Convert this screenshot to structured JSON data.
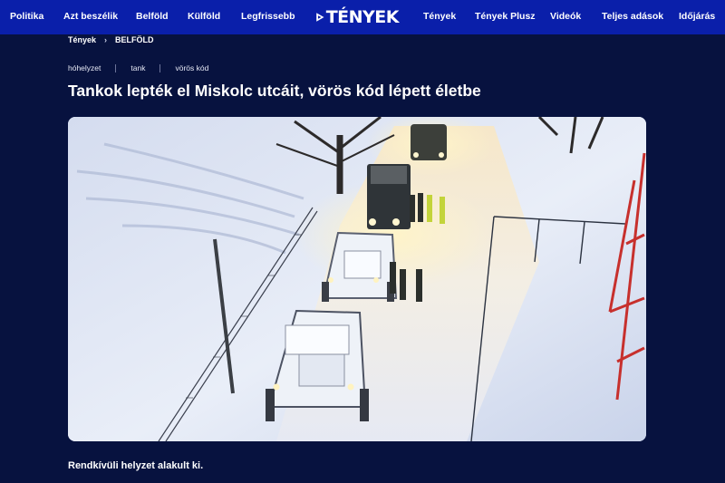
{
  "nav": {
    "left_items": [
      "Politika",
      "Azt beszélik",
      "Belföld",
      "Külföld",
      "Legfrissebb"
    ],
    "logo_text": "TÉNYEK",
    "right_items": [
      "Tények",
      "Tények Plusz",
      "Videók",
      "Teljes adások",
      "Időjárás"
    ],
    "colors": {
      "bar": "#0a1faa",
      "page": "#07123f"
    }
  },
  "breadcrumb": {
    "home": "Tények",
    "separator_icon": "chevron-right-icon",
    "current": "BELFÖLD"
  },
  "tags": [
    "hóhelyzet",
    "tank",
    "vörös kód"
  ],
  "article": {
    "headline": "Tankok lepték el Miskolc utcáit, vörös kód lépett életbe",
    "lead": "Rendkívüli helyzet alakult ki."
  }
}
